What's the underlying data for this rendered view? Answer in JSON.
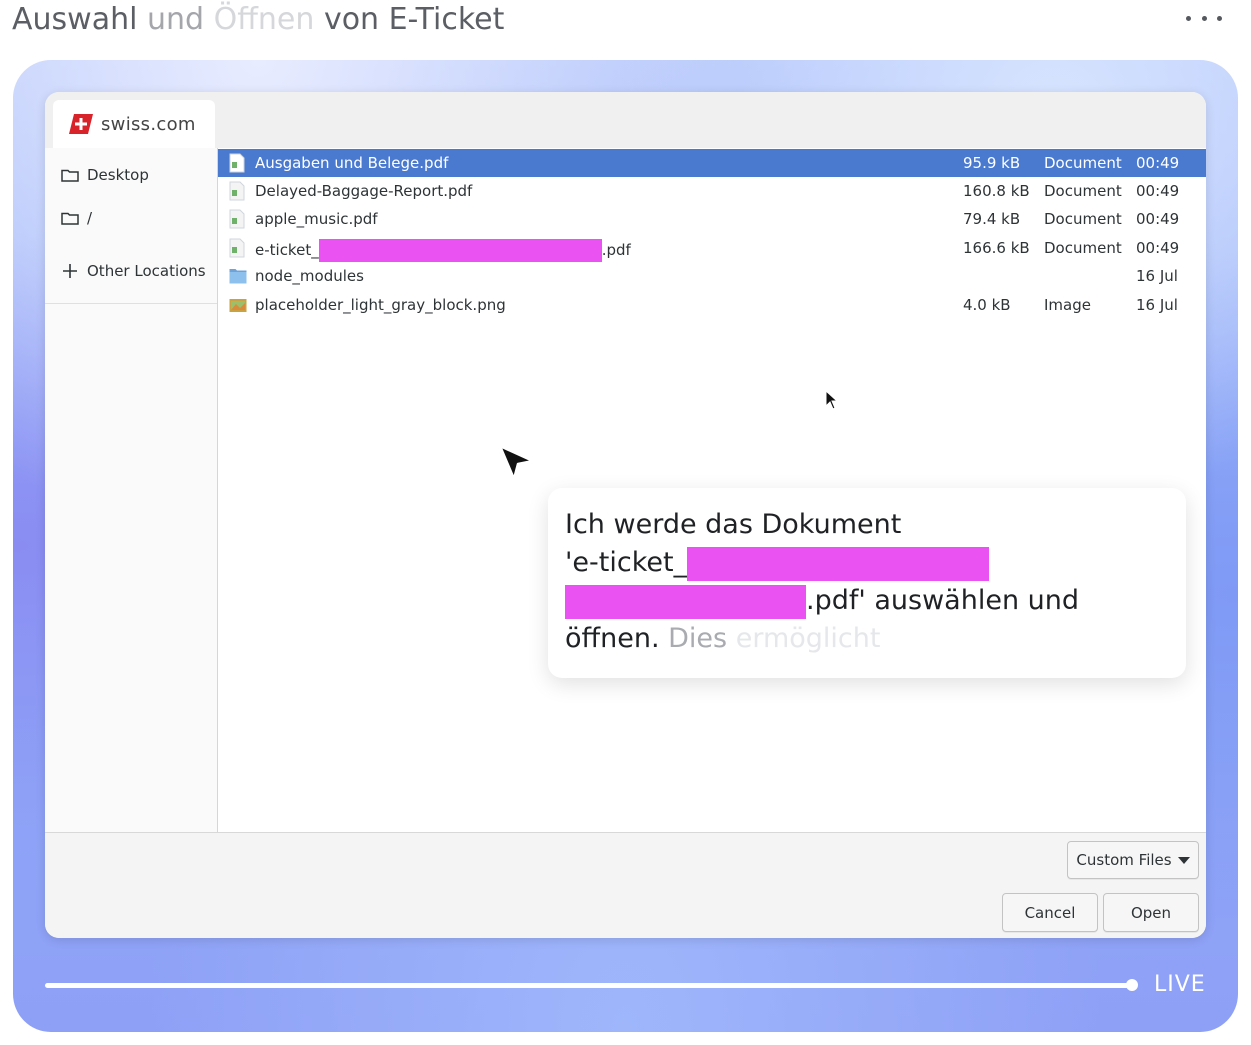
{
  "page": {
    "title_parts": [
      "Auswahl",
      "und",
      "Öffnen",
      "von E-Ticket"
    ],
    "more_icon": "ellipsis-icon"
  },
  "dialog": {
    "tab_label": "swiss.com",
    "sidebar": {
      "desktop": "Desktop",
      "root": "/",
      "other_locations": "Other Locations"
    },
    "files": [
      {
        "name": "Ausgaben und Belege.pdf",
        "size": "95.9 kB",
        "type": "Document",
        "modified": "00:49",
        "selected": true,
        "icon": "pdf-file-icon"
      },
      {
        "name": "Delayed-Baggage-Report.pdf",
        "size": "160.8 kB",
        "type": "Document",
        "modified": "00:49",
        "selected": false,
        "icon": "pdf-file-icon"
      },
      {
        "name": "apple_music.pdf",
        "size": "79.4 kB",
        "type": "Document",
        "modified": "00:49",
        "selected": false,
        "icon": "pdf-file-icon"
      },
      {
        "name_prefix": "e-ticket_",
        "name_suffix": ".pdf",
        "size": "166.6 kB",
        "type": "Document",
        "modified": "00:49",
        "selected": false,
        "icon": "pdf-file-icon"
      },
      {
        "name": "node_modules",
        "size": "",
        "type": "",
        "modified": "16 Jul",
        "selected": false,
        "icon": "folder-icon"
      },
      {
        "name": "placeholder_light_gray_block.png",
        "size": "4.0 kB",
        "type": "Image",
        "modified": "16 Jul",
        "selected": false,
        "icon": "image-file-icon"
      }
    ],
    "filter_label": "Custom Files",
    "cancel_label": "Cancel",
    "open_label": "Open"
  },
  "bubble": {
    "line1": "Ich werde das Dokument",
    "line2_prefix": "'e-ticket_",
    "line3_suffix": ".pdf' auswählen und",
    "line4": "öffnen.",
    "fade1": "Dies",
    "fade2": "ermöglicht"
  },
  "player": {
    "live_label": "LIVE"
  },
  "colors": {
    "selection": "#4a79d0",
    "redaction": "#ea53f2"
  }
}
